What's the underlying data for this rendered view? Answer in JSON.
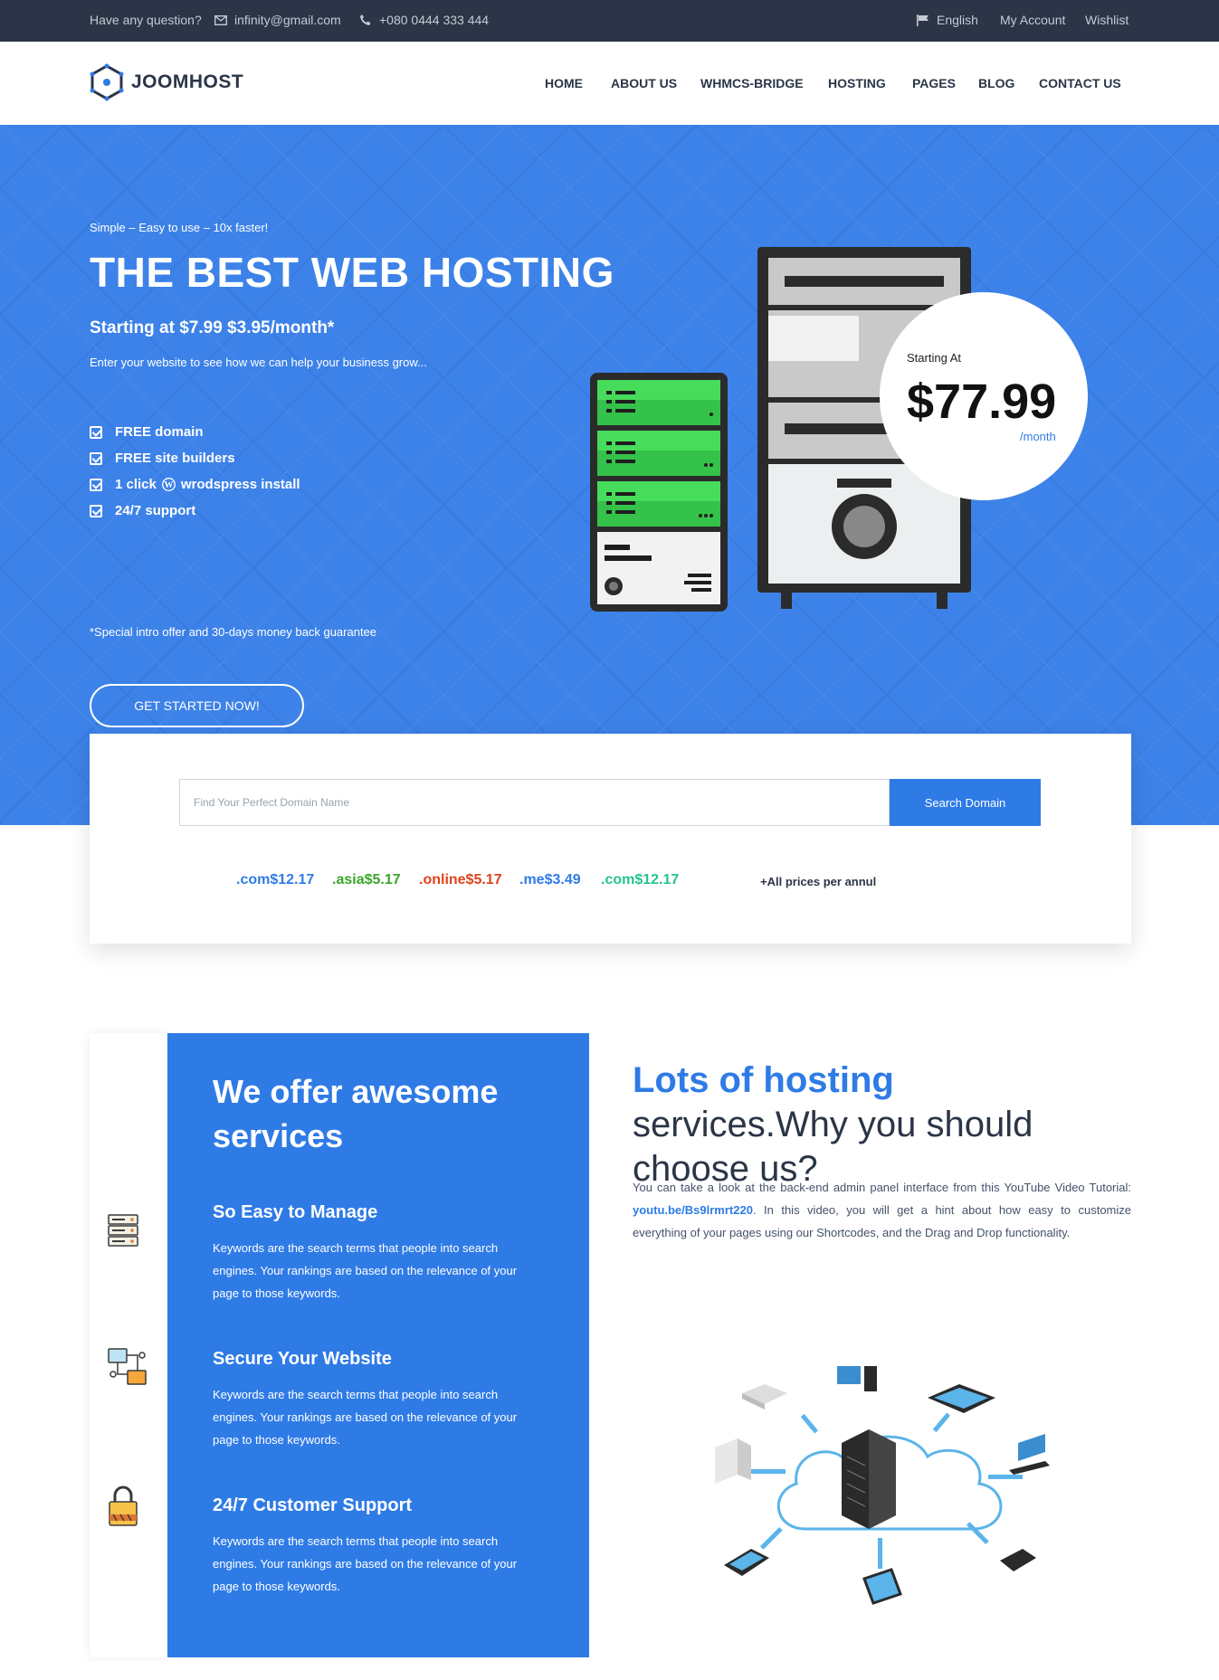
{
  "topbar": {
    "question": "Have any question?",
    "email": "infinity@gmail.com",
    "phone": "+080 0444 333 444",
    "language": "English",
    "account": "My Account",
    "wishlist": "Wishlist"
  },
  "brand": {
    "name": "JOOMHOST"
  },
  "nav": [
    "HOME",
    "ABOUT US",
    "WHMCS-BRIDGE",
    "HOSTING",
    "PAGES",
    "BLOG",
    "CONTACT US"
  ],
  "hero": {
    "tagline": "Simple – Easy to use – 10x faster!",
    "title": "THE BEST WEB HOSTING",
    "price_line": "Starting at $7.99 $3.95/month*",
    "subtitle": "Enter your website to see how we can help your business grow...",
    "features": [
      "FREE domain",
      "FREE site builders",
      "1 click",
      "wrodspress install",
      "24/7 support"
    ],
    "cta": "GET STARTED NOW!",
    "note": "*Special intro offer and 30-days money back guarantee",
    "badge": {
      "label": "Starting At",
      "price": "$77.99",
      "period": "/month"
    }
  },
  "domain": {
    "placeholder": "Find Your Perfect Domain Name",
    "button": "Search Domain",
    "tlds": [
      {
        "text": ".com$12.17",
        "color": "#2f7be6"
      },
      {
        "text": ".asia$5.17",
        "color": "#3aa529"
      },
      {
        "text": ".online$5.17",
        "color": "#e0431b"
      },
      {
        "text": ".me$3.49",
        "color": "#2f7be6"
      },
      {
        "text": ".com$12.17",
        "color": "#25c48a"
      }
    ],
    "note": "+All prices per annul"
  },
  "services": {
    "heading": [
      "We offer awesome",
      "services"
    ],
    "items": [
      {
        "icon": "server-rack-icon",
        "title": "So Easy to Manage",
        "desc": "Keywords are the search terms that people into search engines. Your rankings are based on the relevance of your page to those keywords."
      },
      {
        "icon": "network-icon",
        "title": "Secure Your Website",
        "desc": "Keywords are the search terms that people into search engines. Your rankings are based on the relevance of your page to those keywords."
      },
      {
        "icon": "padlock-icon",
        "title": "24/7 Customer Support",
        "desc": "Keywords are the search terms that people into search engines. Your rankings are based on the relevance of your page to those keywords."
      }
    ]
  },
  "why": {
    "title_highlight": "Lots of hosting",
    "title_rest": " services.Why you should choose us?",
    "desc_before": "You can take a look at the back-end admin panel interface from this YouTube Video Tutorial: ",
    "desc_link": "youtu.be/Bs9lrmrt220",
    "desc_after": ". In this video, you will get a hint about how easy to customize everything of your pages using our Shortcodes, and the Drag and Drop functionality."
  },
  "colors": {
    "topbar": "#2b3547",
    "hero": "#3d82e8",
    "accent": "#2f7be6"
  }
}
